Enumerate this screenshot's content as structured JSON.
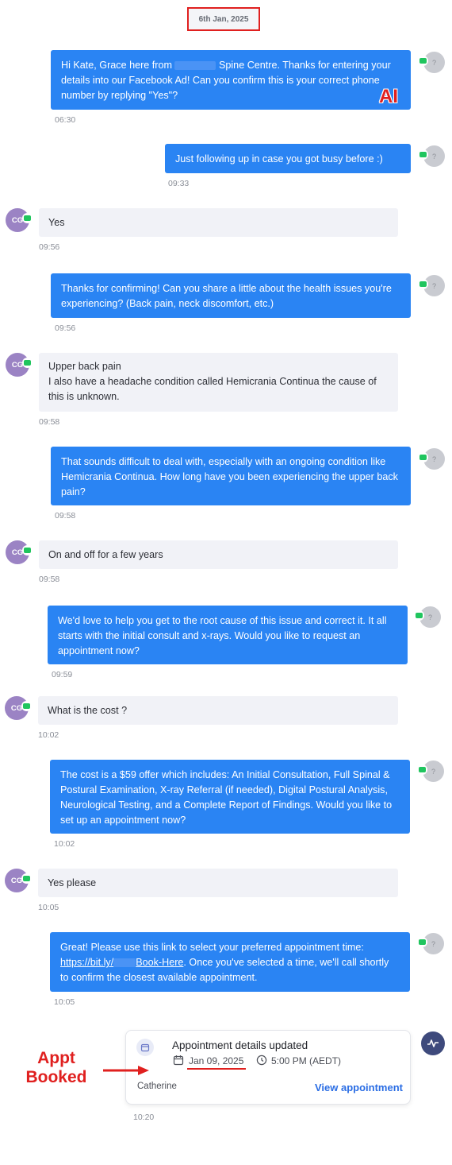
{
  "date_chip": "6th Jan, 2025",
  "messages": [
    {
      "dir": "out",
      "text_a": "Hi Kate, Grace here from",
      "text_b": "Spine Centre. Thanks for entering your details into our Facebook Ad! Can you confirm this is your correct phone number by replying \"Yes\"?",
      "time": "06:30"
    },
    {
      "dir": "out",
      "text": "Just following up in case you got busy before :)",
      "time": "09:33"
    },
    {
      "dir": "in",
      "text": "Yes",
      "time": "09:56"
    },
    {
      "dir": "out",
      "text": "Thanks for confirming! Can you share a little about the health issues you're experiencing? (Back pain, neck discomfort, etc.)",
      "time": "09:56"
    },
    {
      "dir": "in",
      "text_line1": "Upper back pain",
      "text_line2": "I also have a headache condition called Hemicrania Continua the cause of this is unknown.",
      "time": "09:58"
    },
    {
      "dir": "out",
      "text": "That sounds difficult to deal with, especially with an ongoing condition like Hemicrania Continua. How long have you been experiencing the upper back pain?",
      "time": "09:58"
    },
    {
      "dir": "in",
      "text": "On and off for a few years",
      "time": "09:58"
    },
    {
      "dir": "out",
      "text": "We'd love to help you get to the root cause of this issue and correct it. It all starts with the initial consult and x-rays. Would you like to request an appointment now?",
      "time": "09:59"
    },
    {
      "dir": "in",
      "text": "What is the cost ?",
      "time": "10:02"
    },
    {
      "dir": "out",
      "text": "The cost is a $59 offer which includes: An Initial Consultation, Full Spinal & Postural Examination, X-ray Referral (if needed), Digital Postural Analysis, Neurological Testing, and a Complete Report of Findings. Would you like to set up an appointment now?",
      "time": "10:02"
    },
    {
      "dir": "in",
      "text": "Yes please",
      "time": "10:05"
    },
    {
      "dir": "out",
      "text_a": "Great! Please use this link to select your preferred appointment time:",
      "link_a": "https://bit.ly/",
      "link_b": "Book-Here",
      "text_b": ". Once you've selected a time, we'll call shortly to confirm the closest available appointment.",
      "time": "10:05"
    }
  ],
  "agent_avatar": "?",
  "user_avatar": "CG",
  "annotations": {
    "ai": "AI",
    "booked": "Appt Booked"
  },
  "appointment": {
    "title": "Appointment details updated",
    "date": "Jan 09, 2025",
    "time": "5:00 PM (AEDT)",
    "user": "Catherine",
    "view_label": "View appointment",
    "timestamp": "10:20"
  },
  "colors": {
    "outgoing_bubble": "#2a84f3",
    "incoming_bubble": "#f1f2f7",
    "annotation_red": "#e0201f",
    "user_avatar": "#9b83c4",
    "link_blue": "#2a6de4"
  }
}
